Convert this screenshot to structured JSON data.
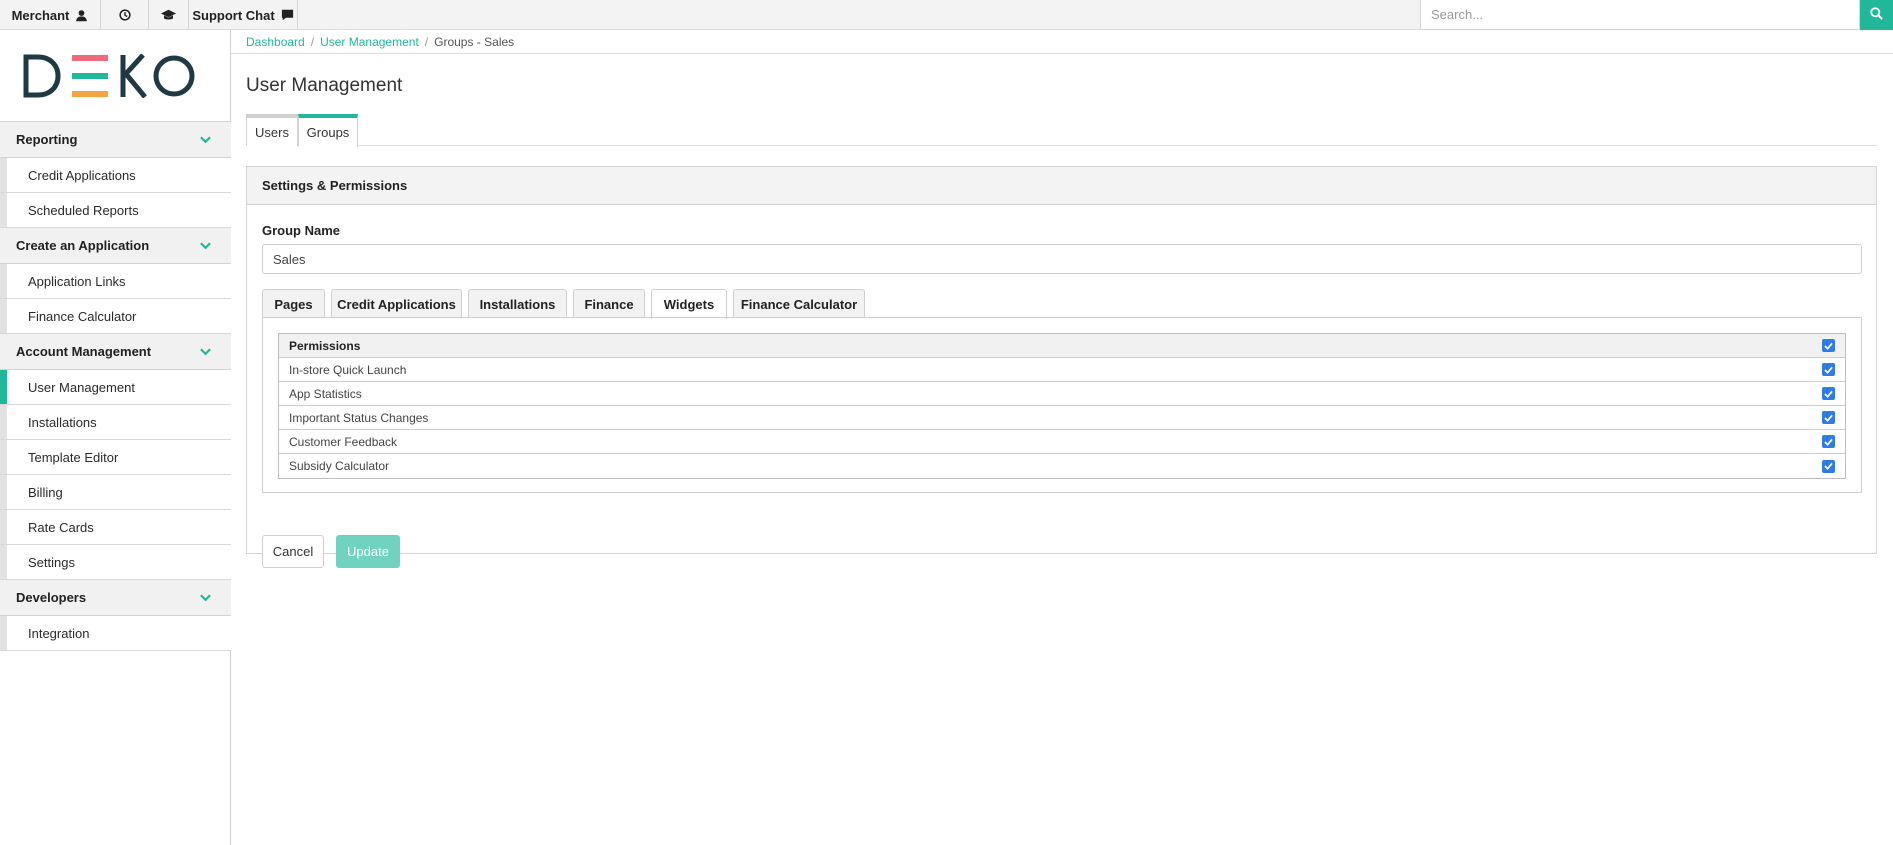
{
  "topbar": {
    "merchant_label": "Merchant",
    "merchant_icon": "user-icon",
    "history_icon": "clock-icon",
    "training_icon": "graduation-cap-icon",
    "support_label": "Support Chat",
    "support_icon": "chat-bubble-icon",
    "search_placeholder": "Search...",
    "search_icon": "search-icon"
  },
  "brand": {
    "logo_text": "DEKO",
    "colors": {
      "dark": "#1f3a44",
      "pink": "#f06a7e",
      "teal": "#21b79a",
      "orange": "#f2a541"
    }
  },
  "sidebar": {
    "groups": [
      {
        "label": "Reporting",
        "items": [
          "Credit Applications",
          "Scheduled Reports"
        ]
      },
      {
        "label": "Create an Application",
        "items": [
          "Application Links",
          "Finance Calculator"
        ]
      },
      {
        "label": "Account Management",
        "items": [
          "User Management",
          "Installations",
          "Template Editor",
          "Billing",
          "Rate Cards",
          "Settings"
        ]
      },
      {
        "label": "Developers",
        "items": [
          "Integration"
        ]
      }
    ],
    "active_item": "User Management"
  },
  "breadcrumb": {
    "items": [
      "Dashboard",
      "User Management",
      "Groups - Sales"
    ],
    "separator": "/"
  },
  "page": {
    "title": "User Management",
    "tabs": [
      "Users",
      "Groups"
    ],
    "active_tab": "Groups"
  },
  "panel": {
    "title": "Settings & Permissions",
    "group_name_label": "Group Name",
    "group_name_value": "Sales",
    "tabs": [
      "Pages",
      "Credit Applications",
      "Installations",
      "Finance",
      "Widgets",
      "Finance Calculator"
    ],
    "active_tab": "Widgets",
    "permissions": {
      "header": "Permissions",
      "header_checked": true,
      "rows": [
        {
          "label": "In-store Quick Launch",
          "checked": true
        },
        {
          "label": "App Statistics",
          "checked": true
        },
        {
          "label": "Important Status Changes",
          "checked": true
        },
        {
          "label": "Customer Feedback",
          "checked": true
        },
        {
          "label": "Subsidy Calculator",
          "checked": true
        }
      ]
    },
    "cancel_label": "Cancel",
    "update_label": "Update"
  },
  "colors": {
    "accent": "#21b79a",
    "update_button": "#6fd3c0",
    "checkbox": "#2f7ce6"
  }
}
